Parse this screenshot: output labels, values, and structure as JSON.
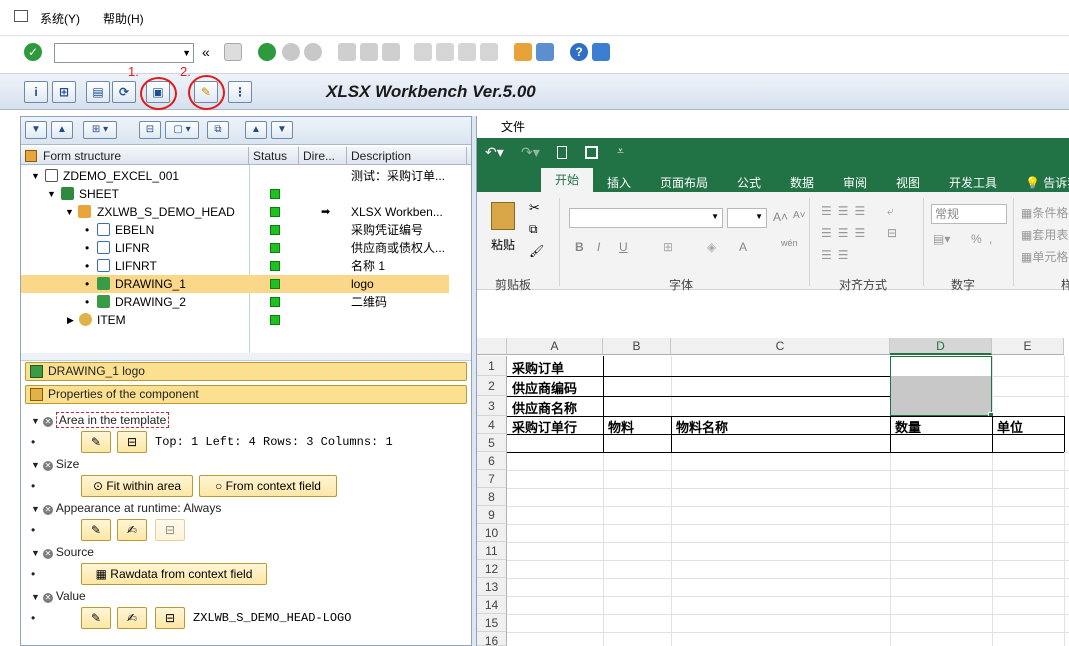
{
  "menu": {
    "system": "系统(Y)",
    "help": "帮助(H)"
  },
  "toolbar": {
    "command_value": ""
  },
  "app": {
    "title": "XLSX Workbench Ver.5.00",
    "annotation_1": "1.",
    "annotation_2": "2."
  },
  "tree": {
    "columns": [
      "Form structure",
      "Status",
      "Dire...",
      "Description"
    ],
    "rows": [
      {
        "label": "ZDEMO_EXCEL_001",
        "desc": "测试：采购订单...",
        "status": false,
        "arrow": false
      },
      {
        "label": "SHEET",
        "desc": "",
        "status": true,
        "arrow": false
      },
      {
        "label": "ZXLWB_S_DEMO_HEAD",
        "desc": "XLSX Workben...",
        "status": true,
        "arrow": true
      },
      {
        "label": "EBELN",
        "desc": "采购凭证编号",
        "status": true,
        "arrow": false
      },
      {
        "label": "LIFNR",
        "desc": "供应商或债权人...",
        "status": true,
        "arrow": false
      },
      {
        "label": "LIFNRT",
        "desc": "名称 1",
        "status": true,
        "arrow": false
      },
      {
        "label": "DRAWING_1",
        "desc": "logo",
        "status": true,
        "arrow": false
      },
      {
        "label": "DRAWING_2",
        "desc": "二维码",
        "status": true,
        "arrow": false
      },
      {
        "label": "ITEM",
        "desc": "",
        "status": true,
        "arrow": false
      }
    ]
  },
  "component": {
    "name": "DRAWING_1  logo",
    "props_title": "Properties of the component"
  },
  "props": {
    "area_label": "Area in the template",
    "area_value": "Top: 1 Left: 4 Rows: 3 Columns: 1",
    "size_label": "Size",
    "fit_within_area": "Fit within area",
    "from_context_field": "From context field",
    "appearance_label": "Appearance at runtime: Always",
    "source_label": "Source",
    "rawdata_button": "Rawdata from context field",
    "value_label": "Value",
    "value_text": "ZXLWB_S_DEMO_HEAD-LOGO"
  },
  "excel": {
    "file_tab": "文件",
    "tabs": [
      "开始",
      "插入",
      "页面布局",
      "公式",
      "数据",
      "审阅",
      "视图",
      "开发工具",
      "告诉我"
    ],
    "paste": "粘贴",
    "clipboard": "剪贴板",
    "font_group": "字体",
    "align_group": "对齐方式",
    "number_group": "数字",
    "number_format": "常规",
    "cond_format": "条件格",
    "format_table": "套用表",
    "cell_styles": "单元格",
    "style_group": "样",
    "columns": [
      "A",
      "B",
      "C",
      "D",
      "E"
    ],
    "rows": [
      "1",
      "2",
      "3",
      "4",
      "5",
      "6",
      "7",
      "8",
      "9",
      "10",
      "11",
      "12",
      "13",
      "14",
      "15",
      "16"
    ],
    "a1": "采购订单",
    "a2": "供应商编码",
    "a3": "供应商名称",
    "a4": "采购订单行",
    "b4": "物料",
    "c4": "物料名称",
    "d4": "数量",
    "e4": "单位"
  }
}
